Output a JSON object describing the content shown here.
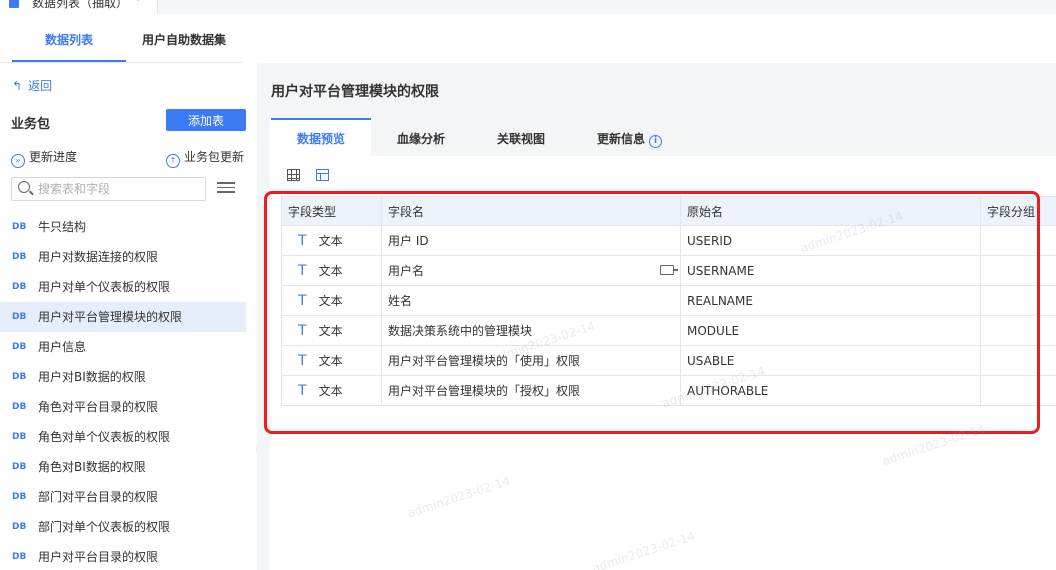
{
  "window_tab": {
    "label": "数据列表（抽取）"
  },
  "left_tabs": [
    {
      "label": "数据列表"
    },
    {
      "label": "用户自助数据集"
    }
  ],
  "back_label": "返回",
  "biz_pkg": {
    "title": "业务包",
    "add_table": "添加表",
    "update_progress": "更新进度",
    "pkg_update": "业务包更新"
  },
  "search": {
    "placeholder": "搜索表和字段"
  },
  "tree_items": [
    {
      "tag": "DB",
      "label": "牛只结构"
    },
    {
      "tag": "DB",
      "label": "用户对数据连接的权限"
    },
    {
      "tag": "DB",
      "label": "用户对单个仪表板的权限"
    },
    {
      "tag": "DB",
      "label": "用户对平台管理模块的权限"
    },
    {
      "tag": "DB",
      "label": "用户信息"
    },
    {
      "tag": "DB",
      "label": "用户对BI数据的权限"
    },
    {
      "tag": "DB",
      "label": "角色对平台目录的权限"
    },
    {
      "tag": "DB",
      "label": "角色对单个仪表板的权限"
    },
    {
      "tag": "DB",
      "label": "角色对BI数据的权限"
    },
    {
      "tag": "DB",
      "label": "部门对平台目录的权限"
    },
    {
      "tag": "DB",
      "label": "部门对单个仪表板的权限"
    },
    {
      "tag": "DB",
      "label": "用户对平台目录的权限"
    }
  ],
  "main": {
    "title": "用户对平台管理模块的权限",
    "tabs": [
      {
        "label": "数据预览"
      },
      {
        "label": "血缘分析"
      },
      {
        "label": "关联视图"
      },
      {
        "label": "更新信息"
      }
    ]
  },
  "table": {
    "columns": [
      "字段类型",
      "字段名",
      "原始名",
      "字段分组"
    ],
    "rows": [
      {
        "type": "文本",
        "field": "用户 ID",
        "original": "USERID",
        "group": ""
      },
      {
        "type": "文本",
        "field": "用户名",
        "original": "USERNAME",
        "group": ""
      },
      {
        "type": "文本",
        "field": "姓名",
        "original": "REALNAME",
        "group": ""
      },
      {
        "type": "文本",
        "field": "数据决策系统中的管理模块",
        "original": "MODULE",
        "group": ""
      },
      {
        "type": "文本",
        "field": "用户对平台管理模块的「使用」权限",
        "original": "USABLE",
        "group": ""
      },
      {
        "type": "文本",
        "field": "用户对平台管理模块的「授权」权限",
        "original": "AUTHORABLE",
        "group": ""
      }
    ]
  },
  "watermark": "admin2023-02-14",
  "colors": {
    "accent": "#3d7bf5",
    "highlight": "#ee1c1c",
    "selected_bg": "#e6eefb",
    "header_bg": "#edf2fb"
  },
  "icons": {
    "type_text": "text-type-icon",
    "back": "back-arrow-icon",
    "info": "info-icon"
  }
}
